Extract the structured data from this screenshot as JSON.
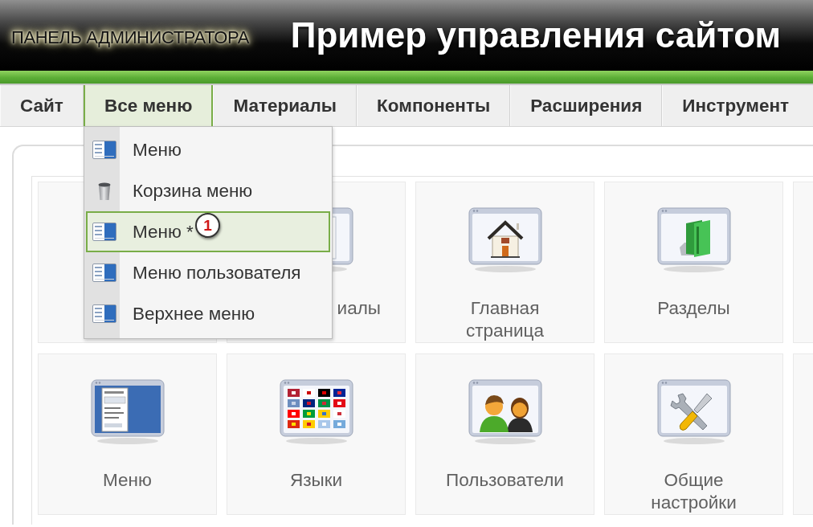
{
  "header": {
    "panel_label": "ПАНЕЛЬ АДМИНИСТРАТОРА",
    "title": "Пример управления сайтом"
  },
  "tabs": [
    {
      "label": "Сайт",
      "selected": false
    },
    {
      "label": "Все меню",
      "selected": true
    },
    {
      "label": "Материалы",
      "selected": false
    },
    {
      "label": "Компоненты",
      "selected": false
    },
    {
      "label": "Расширения",
      "selected": false
    },
    {
      "label": "Инструмент",
      "selected": false
    }
  ],
  "dropdown": {
    "items": [
      {
        "kind": "menu",
        "label": "Меню",
        "selected": false
      },
      {
        "kind": "trash",
        "label": "Корзина меню",
        "selected": false
      },
      {
        "kind": "menu",
        "label": "Меню *",
        "selected": true,
        "callout": "1"
      },
      {
        "kind": "menu",
        "label": "Меню пользователя",
        "selected": false
      },
      {
        "kind": "menu",
        "label": "Верхнее меню",
        "selected": false
      }
    ]
  },
  "tiles": [
    [
      {
        "kind": "hidden"
      },
      {
        "kind": "partly_hidden",
        "label": "иалы"
      },
      {
        "kind": "full",
        "label": "Главная страница"
      },
      {
        "kind": "full",
        "label": "Разделы"
      }
    ],
    [
      {
        "kind": "full",
        "label": "Меню"
      },
      {
        "kind": "full",
        "label": "Языки"
      },
      {
        "kind": "full",
        "label": "Пользователи"
      },
      {
        "kind": "full",
        "label": "Общие настройки"
      }
    ]
  ]
}
